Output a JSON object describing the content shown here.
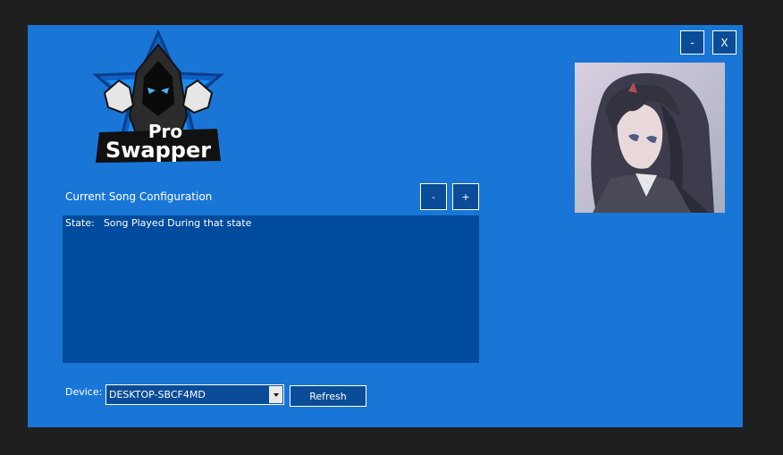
{
  "window": {
    "minimize_label": "-",
    "close_label": "X"
  },
  "logo": {
    "text_line1": "Pro",
    "text_line2": "Swapper"
  },
  "song_config": {
    "title": "Current Song Configuration",
    "remove_label": "-",
    "add_label": "+",
    "columns": [
      "State:",
      "Song Played During that state"
    ]
  },
  "device": {
    "label": "Device:",
    "selected": "DESKTOP-SBCF4MD",
    "refresh_label": "Refresh"
  },
  "colors": {
    "window_bg": "#1976d6",
    "list_bg": "#004b9d",
    "button_bg": "#0a4c97"
  },
  "icons": {
    "logo": "hooded-figure-logo",
    "avatar": "anime-girl-avatar",
    "dropdown": "chevron-down-icon"
  }
}
